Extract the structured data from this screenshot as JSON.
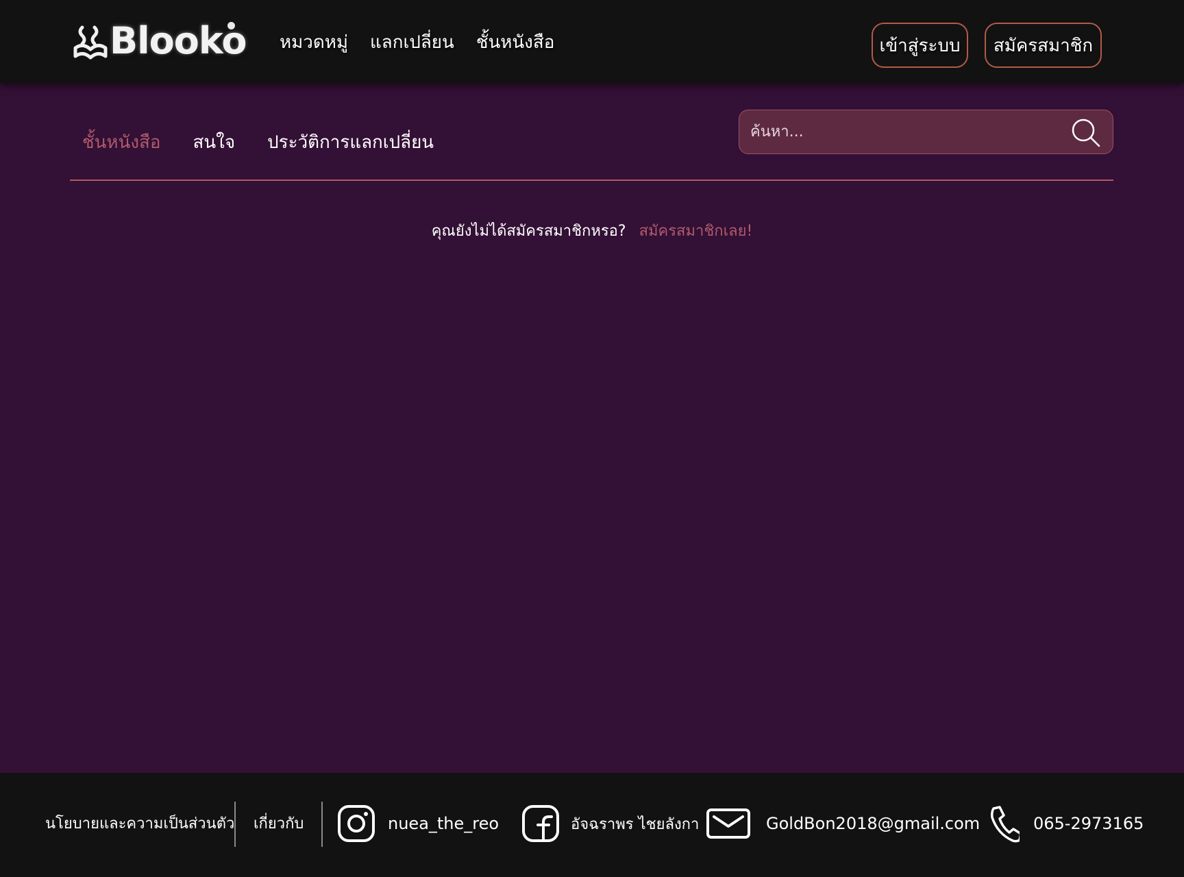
{
  "header": {
    "logo_text": "Blooko",
    "nav": [
      "หมวดหมู่",
      "แลกเปลี่ยน",
      "ชั้นหนังสือ"
    ],
    "login_label": "เข้าสู่ระบบ",
    "signup_label": "สมัครสมาชิก"
  },
  "subnav": {
    "tabs": [
      {
        "label": "ชั้นหนังสือ",
        "active": true
      },
      {
        "label": "สนใจ",
        "active": false
      },
      {
        "label": "ประวัติการแลกเปลี่ยน",
        "active": false
      }
    ]
  },
  "search": {
    "placeholder": "ค้นหา...",
    "value": "",
    "icon": "search-icon"
  },
  "main": {
    "prompt_text": "คุณยังไม่ได้สมัครสมาชิกหรอ?",
    "prompt_link": "สมัครสมาชิกเลย!"
  },
  "footer": {
    "privacy": "นโยบายและความเป็นส่วนตัว",
    "about": "เกี่ยวกับ",
    "instagram": "nuea_the_reo",
    "facebook": "อัจฉราพร ไชยลังกา",
    "email": "GoldBon2018@gmail.com",
    "phone": "065-2973165"
  },
  "colors": {
    "background": "#331035",
    "topbar": "#121212",
    "accent": "#b05a6c",
    "button_border": "#b35a4b",
    "search_bg": "#5e2a42"
  }
}
